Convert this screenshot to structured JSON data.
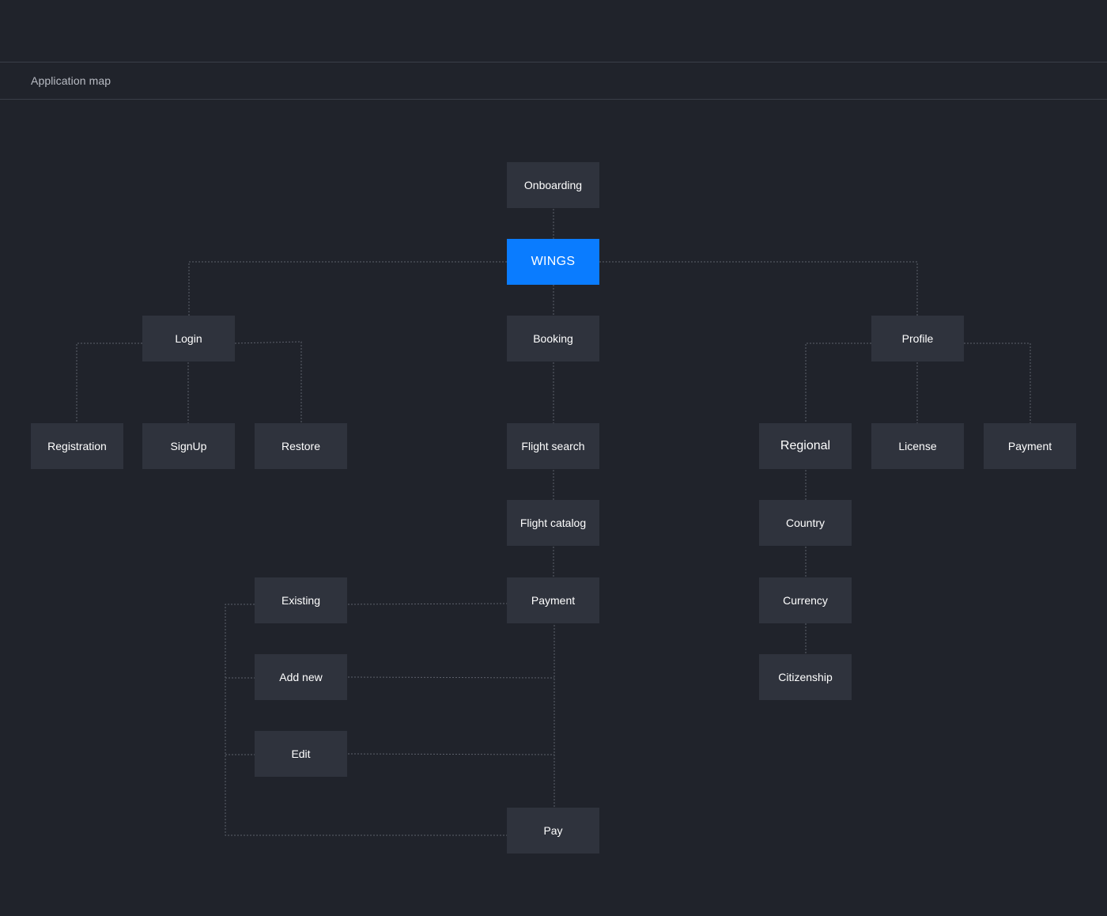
{
  "header": {
    "title": "Application map"
  },
  "nodes": {
    "onboarding": "Onboarding",
    "wings": "WINGS",
    "login": "Login",
    "booking": "Booking",
    "profile": "Profile",
    "registration": "Registration",
    "signup": "SignUp",
    "restore": "Restore",
    "flight_search": "Flight search",
    "regional": "Regional",
    "license": "License",
    "profile_payment": "Payment",
    "flight_catalog": "Flight catalog",
    "country": "Country",
    "existing": "Existing",
    "booking_payment": "Payment",
    "currency": "Currency",
    "add_new": "Add new",
    "citizenship": "Citizenship",
    "edit": "Edit",
    "pay": "Pay"
  },
  "colors": {
    "background": "#20232b",
    "node": "#2f333d",
    "root_node": "#0a7cff",
    "connector": "#5c606b"
  }
}
